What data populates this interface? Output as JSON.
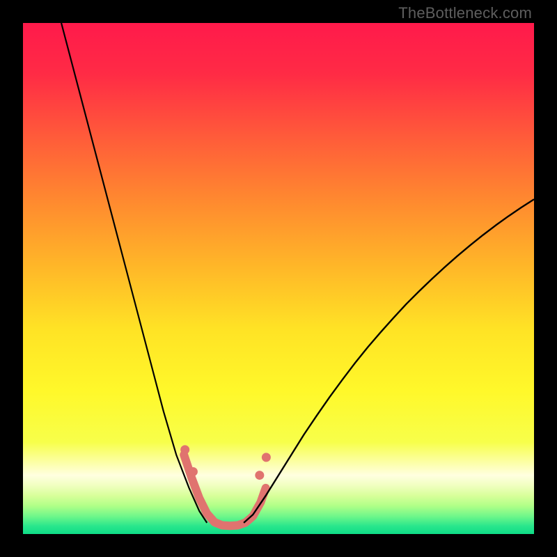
{
  "watermark": {
    "text": "TheBottleneck.com"
  },
  "chart_data": {
    "type": "line",
    "title": "",
    "xlabel": "",
    "ylabel": "",
    "xlim": [
      0,
      100
    ],
    "ylim": [
      0,
      100
    ],
    "grid": false,
    "background_gradient": {
      "orientation": "vertical",
      "stops": [
        {
          "pos": 0.0,
          "color": "#ff1a4b"
        },
        {
          "pos": 0.1,
          "color": "#ff2b45"
        },
        {
          "pos": 0.22,
          "color": "#ff5a3a"
        },
        {
          "pos": 0.35,
          "color": "#ff8a2f"
        },
        {
          "pos": 0.48,
          "color": "#ffb828"
        },
        {
          "pos": 0.6,
          "color": "#ffe325"
        },
        {
          "pos": 0.72,
          "color": "#fff82a"
        },
        {
          "pos": 0.82,
          "color": "#f7ff4a"
        },
        {
          "pos": 0.885,
          "color": "#ffffe0"
        },
        {
          "pos": 0.905,
          "color": "#f0ffc0"
        },
        {
          "pos": 0.925,
          "color": "#d8ff9a"
        },
        {
          "pos": 0.945,
          "color": "#b0ff88"
        },
        {
          "pos": 0.965,
          "color": "#70f78a"
        },
        {
          "pos": 0.985,
          "color": "#28e68c"
        },
        {
          "pos": 1.0,
          "color": "#0edc86"
        }
      ]
    },
    "series": [
      {
        "name": "left-curve",
        "stroke": "#000000",
        "width": 2.2,
        "x": [
          7.5,
          10,
          12.5,
          15,
          17.5,
          20,
          22.5,
          25,
          27.5,
          30,
          32.5,
          34.5,
          36
        ],
        "y": [
          100,
          90.5,
          81,
          71.5,
          62,
          52.5,
          43,
          33.5,
          24,
          15.5,
          9,
          4.5,
          2.2
        ]
      },
      {
        "name": "valley-blob",
        "stroke": "#e0736f",
        "width": 12,
        "cap": "round",
        "x": [
          31.5,
          33,
          34.5,
          36,
          37.5,
          39,
          40.5,
          42,
          43.5,
          45,
          46.5,
          47.5
        ],
        "y": [
          15.5,
          11,
          7,
          4,
          2.3,
          1.7,
          1.6,
          1.7,
          2.2,
          3.5,
          6.2,
          9
        ]
      },
      {
        "name": "right-curve",
        "stroke": "#000000",
        "width": 2.4,
        "x": [
          43.2,
          45,
          47.5,
          50,
          52.5,
          55,
          57.5,
          60,
          62.5,
          65,
          67.5,
          70,
          72.5,
          75,
          77.5,
          80,
          82.5,
          85,
          87.5,
          90,
          92.5,
          95,
          97.5,
          100
        ],
        "y": [
          2.2,
          3.8,
          7.5,
          11.5,
          15.5,
          19.5,
          23.2,
          26.8,
          30.2,
          33.5,
          36.6,
          39.5,
          42.3,
          45,
          47.5,
          49.9,
          52.2,
          54.4,
          56.5,
          58.5,
          60.4,
          62.2,
          63.9,
          65.5
        ]
      }
    ],
    "points_overlay": [
      {
        "x": 31.7,
        "y": 16.5,
        "r": 6.5,
        "color": "#e0736f"
      },
      {
        "x": 33.3,
        "y": 12.2,
        "r": 6.5,
        "color": "#e0736f"
      },
      {
        "x": 46.3,
        "y": 11.5,
        "r": 6.5,
        "color": "#e0736f"
      },
      {
        "x": 47.6,
        "y": 15.0,
        "r": 6.5,
        "color": "#e0736f"
      }
    ]
  }
}
